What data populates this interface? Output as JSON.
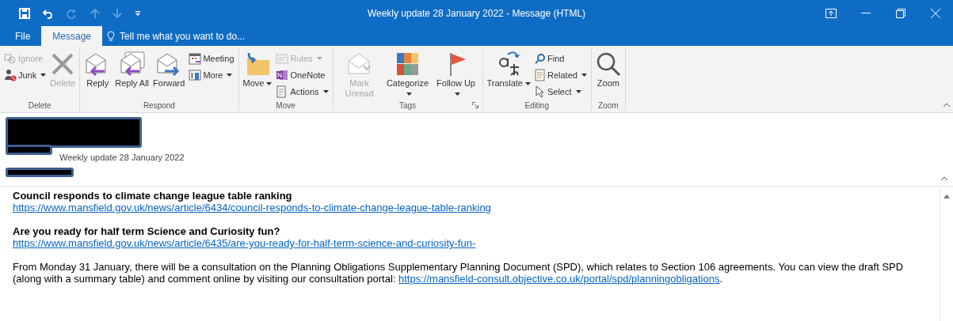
{
  "window": {
    "title": "Weekly update 28 January 2022 - Message (HTML)"
  },
  "quick_access": [
    {
      "disabled": false
    },
    {
      "disabled": false
    },
    {
      "disabled": true
    },
    {
      "disabled": true
    },
    {
      "disabled": true
    },
    {
      "disabled": false
    }
  ],
  "tabs": [
    {
      "label": "File",
      "selected": false
    },
    {
      "label": "Message",
      "selected": true
    }
  ],
  "tell_me": {
    "placeholder": "Tell me what you want to do..."
  },
  "ribbon": {
    "groups": [
      {
        "label": "Delete",
        "items": [
          {
            "kind": "small",
            "label": "Ignore",
            "disabled": true,
            "dropdown": false
          },
          {
            "kind": "small",
            "label": "Junk",
            "disabled": false,
            "dropdown": true
          },
          {
            "kind": "large",
            "label": "Delete",
            "disabled": true,
            "dropdown": false
          }
        ]
      },
      {
        "label": "Respond",
        "items": [
          {
            "kind": "large",
            "label": "Reply",
            "disabled": false,
            "dropdown": false
          },
          {
            "kind": "large",
            "label": "Reply All",
            "disabled": false,
            "dropdown": false
          },
          {
            "kind": "large",
            "label": "Forward",
            "disabled": false,
            "dropdown": false
          },
          {
            "kind": "small",
            "label": "Meeting",
            "disabled": false,
            "dropdown": false
          },
          {
            "kind": "small",
            "label": "More",
            "disabled": false,
            "dropdown": true
          }
        ]
      },
      {
        "label": "Move",
        "items": [
          {
            "kind": "large",
            "label": "Move",
            "disabled": false,
            "dropdown": true
          },
          {
            "kind": "small",
            "label": "Rules",
            "disabled": true,
            "dropdown": true
          },
          {
            "kind": "small",
            "label": "OneNote",
            "disabled": false,
            "dropdown": false
          },
          {
            "kind": "small",
            "label": "Actions",
            "disabled": false,
            "dropdown": true
          }
        ]
      },
      {
        "label": "Tags",
        "launcher": true,
        "items": [
          {
            "kind": "large",
            "label": "Mark Unread",
            "disabled": true,
            "dropdown": false
          },
          {
            "kind": "large",
            "label": "Categorize",
            "disabled": false,
            "dropdown": true
          },
          {
            "kind": "large",
            "label": "Follow Up",
            "disabled": false,
            "dropdown": true
          }
        ]
      },
      {
        "label": "Editing",
        "items": [
          {
            "kind": "large",
            "label": "Translate",
            "disabled": false,
            "dropdown": true
          },
          {
            "kind": "small",
            "label": "Find",
            "disabled": false,
            "dropdown": false
          },
          {
            "kind": "small",
            "label": "Related",
            "disabled": false,
            "dropdown": true
          },
          {
            "kind": "small",
            "label": "Select",
            "disabled": false,
            "dropdown": true
          }
        ]
      },
      {
        "label": "Zoom",
        "items": [
          {
            "kind": "large",
            "label": "Zoom",
            "disabled": false,
            "dropdown": false
          }
        ]
      }
    ]
  },
  "message": {
    "subject": "Weekly update 28 January 2022"
  },
  "body": [
    {
      "kind": "heading",
      "text": "Council responds to climate change league table ranking"
    },
    {
      "kind": "link",
      "text": "https://www.mansfield.gov.uk/news/article/6434/council-responds-to-climate-change-league-table-ranking"
    },
    {
      "kind": "gap"
    },
    {
      "kind": "heading",
      "text": "Are you ready for half term Science and Curiosity fun?"
    },
    {
      "kind": "link",
      "text": "https://www.mansfield.gov.uk/news/article/6435/are-you-ready-for-half-term-science-and-curiosity-fun-"
    },
    {
      "kind": "gap"
    },
    {
      "kind": "paragraph",
      "text": "From Monday 31 January, there will be a consultation on the Planning Obligations Supplementary Planning Document (SPD), which relates to Section 106 agreements. You can view the draft SPD (along with a summary table) and comment online by visiting our consultation portal: ",
      "link": "https://mansfield-consult.objective.co.uk/portal/spd/planningobligations",
      "after": "."
    }
  ]
}
